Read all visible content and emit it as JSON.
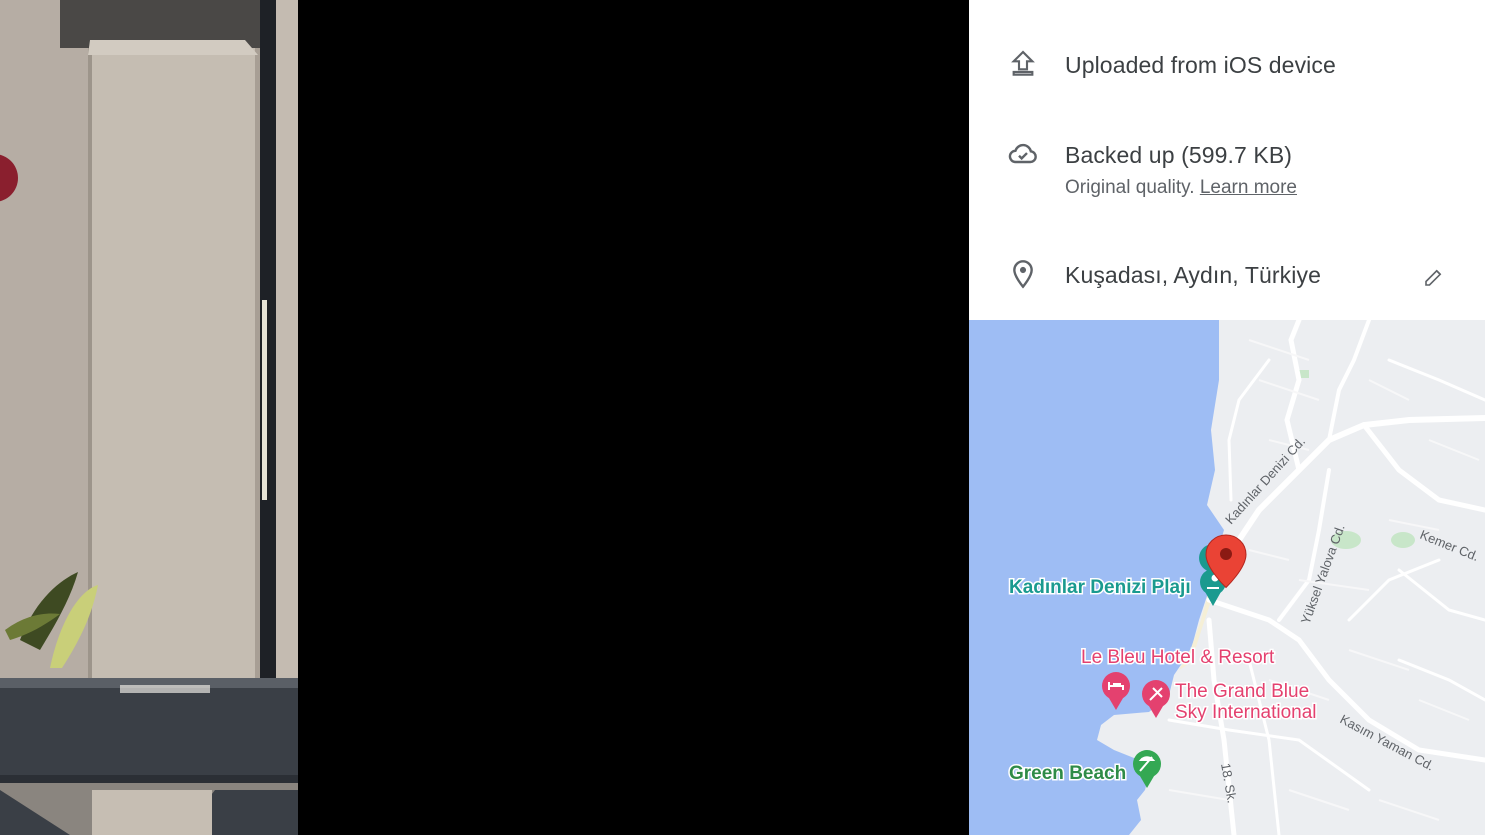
{
  "details": {
    "upload": {
      "text": "Uploaded from iOS device",
      "icon": "upload-icon"
    },
    "backup": {
      "text": "Backed up (599.7 KB)",
      "quality": "Original quality.",
      "learn_more": "Learn more",
      "icon": "cloud-done-icon"
    },
    "location": {
      "text": "Kuşadası, Aydın, Türkiye",
      "icon": "location-pin-icon",
      "edit_icon": "pencil-icon"
    }
  },
  "map": {
    "places": {
      "beach1": "Kadınlar Denizi Plajı",
      "hotel1": "Le Bleu Hotel & Resort",
      "hotel2_line1": "The Grand Blue",
      "hotel2_line2": "Sky International",
      "beach2": "Green Beach"
    },
    "streets": {
      "s1": "Kadınlar Denizi Cd.",
      "s2": "Yüksel Yalova Cd.",
      "s3": "Kemer Cd.",
      "s4": "Kasım Yaman Cd.",
      "s5": "18. Sk."
    },
    "colors": {
      "water": "#9ebdf4",
      "land": "#eceef1",
      "road": "#ffffff",
      "park": "#c8e6c9",
      "pin": "#ea4335",
      "poi_teal": "#1a9a8f",
      "poi_pink": "#e4416f",
      "poi_green": "#34a853"
    }
  }
}
